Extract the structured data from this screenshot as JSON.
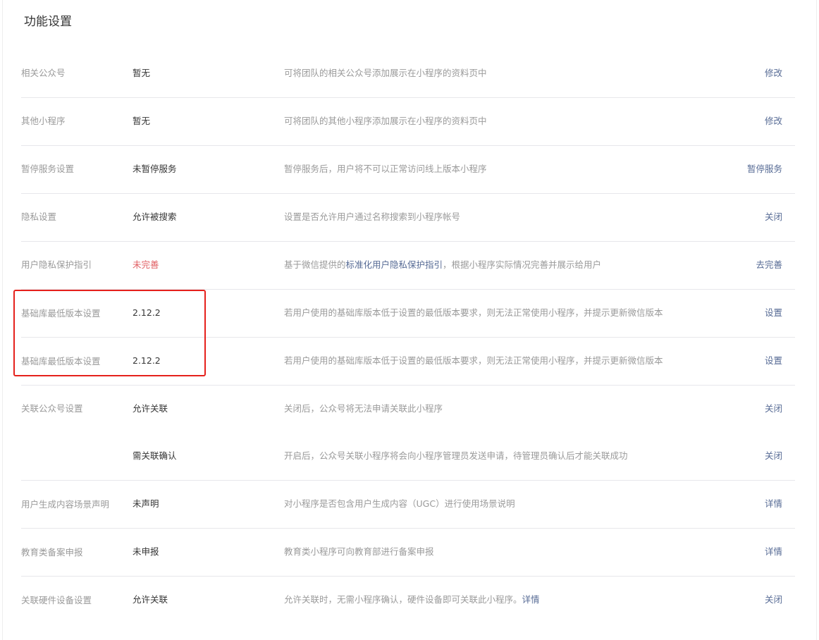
{
  "section_title": "功能设置",
  "rows": [
    {
      "label": "相关公众号",
      "value": "暂无",
      "desc": "可将团队的相关公众号添加展示在小程序的资料页中",
      "action": "修改"
    },
    {
      "label": "其他小程序",
      "value": "暂无",
      "desc": "可将团队的其他小程序添加展示在小程序的资料页中",
      "action": "修改"
    },
    {
      "label": "暂停服务设置",
      "value": "未暂停服务",
      "desc": "暂停服务后，用户将不可以正常访问线上版本小程序",
      "action": "暂停服务"
    },
    {
      "label": "隐私设置",
      "value": "允许被搜索",
      "desc": "设置是否允许用户通过名称搜索到小程序帐号",
      "action": "关闭"
    },
    {
      "label": "用户隐私保护指引",
      "value": "未完善",
      "desc_prefix": "基于微信提供的",
      "desc_link": "标准化用户隐私保护指引",
      "desc_suffix": "，根据小程序实际情况完善并展示给用户",
      "action": "去完善"
    },
    {
      "label": "基础库最低版本设置",
      "value": "2.12.2",
      "desc": "若用户使用的基础库版本低于设置的最低版本要求，则无法正常使用小程序，并提示更新微信版本",
      "action": "设置"
    },
    {
      "label": "基础库最低版本设置",
      "value": "2.12.2",
      "desc": "若用户使用的基础库版本低于设置的最低版本要求，则无法正常使用小程序，并提示更新微信版本",
      "action": "设置"
    },
    {
      "label": "关联公众号设置",
      "value": "允许关联",
      "desc": "关闭后，公众号将无法申请关联此小程序",
      "action": "关闭"
    },
    {
      "label": "",
      "value": "需关联确认",
      "desc": "开启后，公众号关联小程序将会向小程序管理员发送申请，待管理员确认后才能关联成功",
      "action": "关闭"
    },
    {
      "label": "用户生成内容场景声明",
      "value": "未声明",
      "desc": "对小程序是否包含用户生成内容（UGC）进行使用场景说明",
      "action": "详情"
    },
    {
      "label": "教育类备案申报",
      "value": "未申报",
      "desc": "教育类小程序可向教育部进行备案申报",
      "action": "详情"
    },
    {
      "label": "关联硬件设备设置",
      "value": "允许关联",
      "desc_prefix": "允许关联时，无需小程序确认，硬件设备即可关联此小程序。",
      "desc_link": "详情",
      "desc_suffix": "",
      "action": "关闭"
    }
  ]
}
